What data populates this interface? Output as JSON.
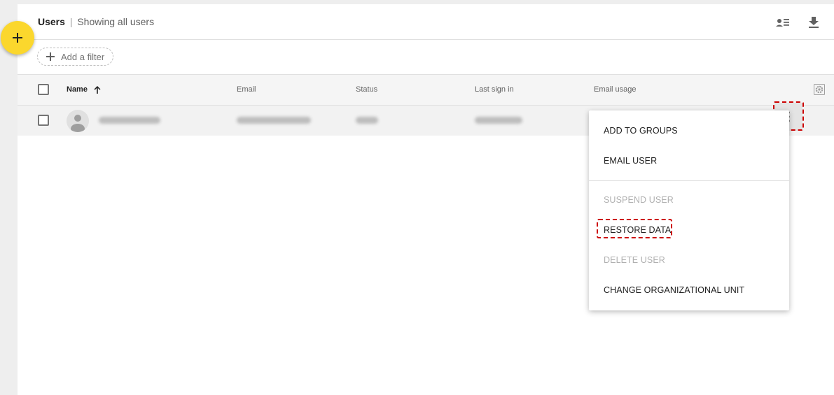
{
  "header": {
    "title": "Users",
    "separator": "|",
    "subtitle": "Showing all users",
    "icons": [
      "user-list-icon",
      "download-icon"
    ]
  },
  "fab": {
    "icon": "plus-icon"
  },
  "filter": {
    "add_label": "Add a filter"
  },
  "table": {
    "columns": {
      "name": "Name",
      "email": "Email",
      "status": "Status",
      "last_sign_in": "Last sign in",
      "email_usage": "Email usage"
    },
    "sort_icon": "arrow-up-icon",
    "settings_icon": "gear-icon"
  },
  "row_menu": {
    "icon": "more-vert-icon",
    "items": [
      {
        "label": "ADD TO GROUPS",
        "enabled": true
      },
      {
        "label": "EMAIL USER",
        "enabled": true
      },
      {
        "label": "SUSPEND USER",
        "enabled": false
      },
      {
        "label": "RESTORE DATA",
        "enabled": true,
        "highlighted": true
      },
      {
        "label": "DELETE USER",
        "enabled": false
      },
      {
        "label": "CHANGE ORGANIZATIONAL UNIT",
        "enabled": true
      }
    ]
  },
  "colors": {
    "fab": "#fbd72d",
    "highlight": "#cc0000",
    "background": "#eeeeee"
  }
}
